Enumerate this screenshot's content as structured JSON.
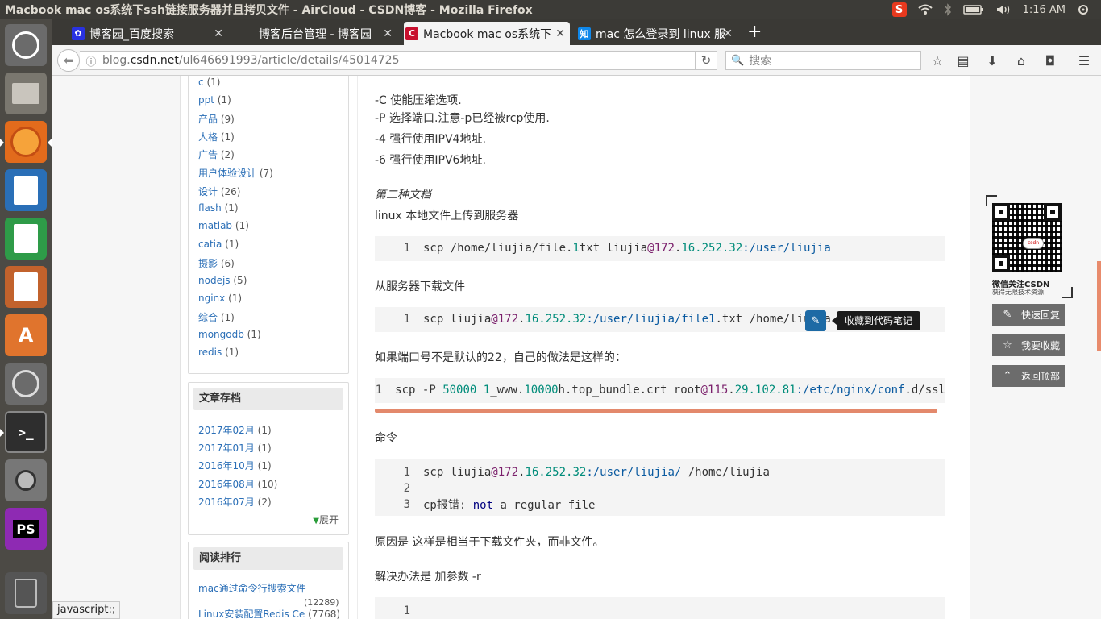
{
  "window": {
    "title": "Macbook mac os系统下ssh链接服务器并且拷贝文件 - AirCloud - CSDN博客 - Mozilla Firefox"
  },
  "panel": {
    "clock": "1:16 AM",
    "sogou": "S"
  },
  "tabs": [
    {
      "label": "博客园_百度搜索",
      "icon": "baidu-paw-icon"
    },
    {
      "label": "博客后台管理 - 博客园",
      "icon": ""
    },
    {
      "label": "Macbook mac os系统下",
      "icon": "csdn-icon"
    },
    {
      "label": "mac 怎么登录到 linux 服",
      "icon": "zhihu-icon",
      "icon_text": "知"
    }
  ],
  "urlbar": {
    "prefix": "blog.",
    "domain": "csdn.net",
    "path": "/ul646691993/article/details/45014725"
  },
  "search": {
    "placeholder": "搜索"
  },
  "sidebar": {
    "categories": [
      {
        "name": "c",
        "count": "(1)"
      },
      {
        "name": "ppt",
        "count": "(1)"
      },
      {
        "name": "产品",
        "count": "(9)"
      },
      {
        "name": "人格",
        "count": "(1)"
      },
      {
        "name": "广告",
        "count": "(2)"
      },
      {
        "name": "用户体验设计",
        "count": "(7)"
      },
      {
        "name": "设计",
        "count": "(26)"
      },
      {
        "name": "flash",
        "count": "(1)"
      },
      {
        "name": "matlab",
        "count": "(1)"
      },
      {
        "name": "catia",
        "count": "(1)"
      },
      {
        "name": "摄影",
        "count": "(6)"
      },
      {
        "name": "nodejs",
        "count": "(5)"
      },
      {
        "name": "nginx",
        "count": "(1)"
      },
      {
        "name": "综合",
        "count": "(1)"
      },
      {
        "name": "mongodb",
        "count": "(1)"
      },
      {
        "name": "redis",
        "count": "(1)"
      }
    ],
    "archive_title": "文章存档",
    "archive": [
      {
        "name": "2017年02月",
        "count": "(1)"
      },
      {
        "name": "2017年01月",
        "count": "(1)"
      },
      {
        "name": "2016年10月",
        "count": "(1)"
      },
      {
        "name": "2016年08月",
        "count": "(10)"
      },
      {
        "name": "2016年07月",
        "count": "(2)"
      }
    ],
    "expand": "展开",
    "rank_title": "阅读排行",
    "rank": [
      {
        "name": "mac通过命令行搜索文件",
        "count": "(12289)"
      },
      {
        "name": "Linux安装配置Redis Ce",
        "count": "(7768)"
      }
    ]
  },
  "article": {
    "line_c": "-C 使能压缩选项.",
    "line_p": "-P 选择端口.注意-p已经被rcp使用.",
    "line_4": "-4 强行使用IPV4地址.",
    "line_6": "-6 强行使用IPV6地址.",
    "h_second": "第二种文档",
    "p_upload": "linux 本地文件上传到服务器",
    "code1": {
      "ln": "1",
      "a": "scp /home/liujia/file.",
      "n1": "1",
      "b": "txt liujia",
      "at": "@172",
      "c": ".",
      "n2": "16.252.32",
      "d": ":/user/liujia"
    },
    "p_download": "从服务器下载文件",
    "code2": {
      "ln": "1",
      "a": "scp liujia",
      "at": "@172",
      "b": ".",
      "n": "16.252.32",
      "path": ":/user/liujia/file1",
      "c": ".txt /home/liujia"
    },
    "tooltip": "收藏到代码笔记",
    "p_port": "如果端口号不是默认的22，自己的做法是这样的：",
    "code3": {
      "ln": "1",
      "a": "scp -P ",
      "n1": "50000",
      "b": " ",
      "n2": "1",
      "c": "_www.",
      "n3": "10000",
      "d": "h.top_bundle.crt root",
      "at": "@115",
      "e": ".",
      "n4": "29.102.81",
      "path": ":/etc/nginx/conf",
      "f": ".d/ssl"
    },
    "p_cmd": "命令",
    "code4": {
      "l1": {
        "ln": "1",
        "a": "scp liujia",
        "at": "@172",
        "b": ".",
        "n": "16.252.32",
        "path": ":/user/liujia/",
        "c": " /home/liujia"
      },
      "l2": {
        "ln": "2"
      },
      "l3": {
        "ln": "3",
        "a": "cp报错: ",
        "kw": "not",
        "b": " a regular file"
      }
    },
    "p_reason": "原因是 这样是相当于下载文件夹，而非文件。",
    "p_solution": "解决办法是 加参数 -r",
    "code5": {
      "ln": "1"
    }
  },
  "qr": {
    "logo": "csdn",
    "t1": "微信关注CSDN",
    "t2": "获得无限技术资源"
  },
  "side_buttons": {
    "reply": "快速回复",
    "fav": "我要收藏",
    "top": "返回顶部"
  },
  "status": "javascript:;"
}
